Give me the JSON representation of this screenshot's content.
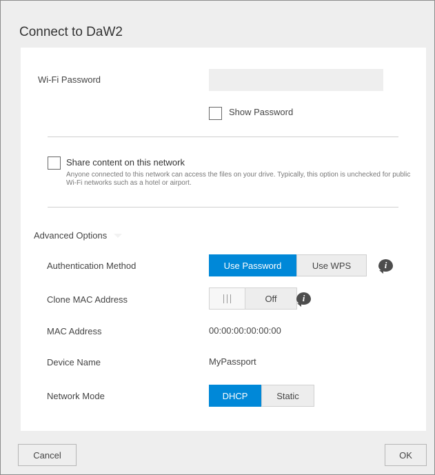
{
  "dialog": {
    "title": "Connect to DaW2"
  },
  "wifi_password": {
    "label": "Wi-Fi Password",
    "value": "",
    "show_password_label": "Show Password",
    "show_password_checked": false
  },
  "share": {
    "title": "Share content on this network",
    "description": "Anyone connected to this network can access the files on your drive. Typically, this option is unchecked for public Wi-Fi networks such as a hotel or airport.",
    "checked": false
  },
  "advanced": {
    "label": "Advanced Options",
    "auth": {
      "label": "Authentication Method",
      "options": [
        "Use Password",
        "Use WPS"
      ],
      "selected": "Use Password"
    },
    "clone_mac": {
      "label": "Clone MAC Address",
      "state": "Off"
    },
    "mac": {
      "label": "MAC Address",
      "value": "00:00:00:00:00:00"
    },
    "device": {
      "label": "Device Name",
      "value": "MyPassport"
    },
    "network_mode": {
      "label": "Network Mode",
      "options": [
        "DHCP",
        "Static"
      ],
      "selected": "DHCP"
    }
  },
  "footer": {
    "cancel_label": "Cancel",
    "ok_label": "OK"
  },
  "colors": {
    "accent": "#0088d8",
    "dialog_bg": "#eeeeee",
    "panel_bg": "#ffffff"
  },
  "icons": {
    "info": "info-icon",
    "dropdown": "chevron-down-icon",
    "toggle_grip": "grip-icon"
  }
}
